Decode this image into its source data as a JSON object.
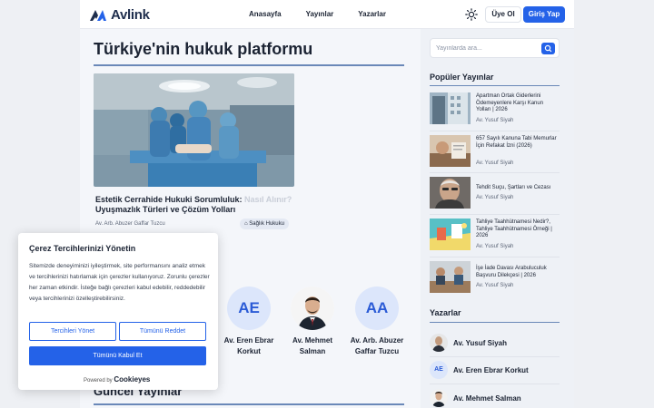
{
  "header": {
    "logo_text": "Avlink",
    "nav": [
      "Anasayfa",
      "Yayınlar",
      "Yazarlar"
    ],
    "login_label": "Üye Ol",
    "signup_label": "Giriş Yap",
    "accent_color": "#2462e8"
  },
  "main": {
    "title": "Türkiye'nin hukuk platformu",
    "hero": {
      "title_line1": "Estetik Cerrahide Hukuki Sorumluluk:",
      "title_ghost": " Nasıl Alınır?",
      "title_line2": "Uyuşmazlık Türleri ve Çözüm Yolları",
      "author": "Av. Arb. Abuzer Gaffar Tuzcu",
      "tag": "Sağlık Hukuku",
      "tag_icon": "tag-icon"
    },
    "authors": [
      {
        "initials": "AE",
        "name": "Av. Eren Ebrar Korkut"
      },
      {
        "initials": "",
        "name": "Av. Mehmet Salman"
      },
      {
        "initials": "AA",
        "name": "Av. Arb. Abuzer Gaffar Tuzcu"
      }
    ],
    "section2_title": "Güncel Yayınlar"
  },
  "sidebar": {
    "search_placeholder": "Yayınlarda ara...",
    "popular_heading": "Popüler Yayınlar",
    "popular": [
      {
        "title": "Apartman Ortak Giderlerini Ödemeyenlere Karşı Kanun Yolları | 2026",
        "author": "Av. Yusuf Siyah"
      },
      {
        "title": "657 Sayılı Kanuna Tabi Memurlar İçin Refakat İzni (2026)",
        "author": "Av. Yusuf Siyah"
      },
      {
        "title": "Tehdit Suçu, Şartları ve Cezası",
        "author": "Av. Yusuf Siyah"
      },
      {
        "title": "Tahliye Taahhütnamesi Nedir?, Tahliye Taahhütnamesi Örneği | 2026",
        "author": "Av. Yusuf Siyah"
      },
      {
        "title": "İşe İade Davası Arabuluculuk Başvuru Dilekçesi | 2026",
        "author": "Av. Yusuf Siyah"
      }
    ],
    "authors_heading": "Yazarlar",
    "authors": [
      {
        "initials": "",
        "name": "Av. Yusuf Siyah"
      },
      {
        "initials": "AE",
        "name": "Av. Eren Ebrar Korkut"
      },
      {
        "initials": "",
        "name": "Av. Mehmet Salman"
      }
    ]
  },
  "cookie": {
    "title": "Çerez Tercihlerinizi Yönetin",
    "text": "Sitemizde deneyiminizi iyileştirmek, site performansını analiz etmek ve tercihlerinizi hatırlamak için çerezler kullanıyoruz. Zorunlu çerezler her zaman etkindir. İsteğe bağlı çerezleri kabul edebilir, reddedebilir veya tercihlerinizi özelleştirebilirsiniz.",
    "customize_label": "Tercihleri Yönet",
    "reject_label": "Tümünü Reddet",
    "accept_label": "Tümünü Kabul Et",
    "powered_prefix": "Powered by",
    "powered_brand": "Cookieyes"
  }
}
